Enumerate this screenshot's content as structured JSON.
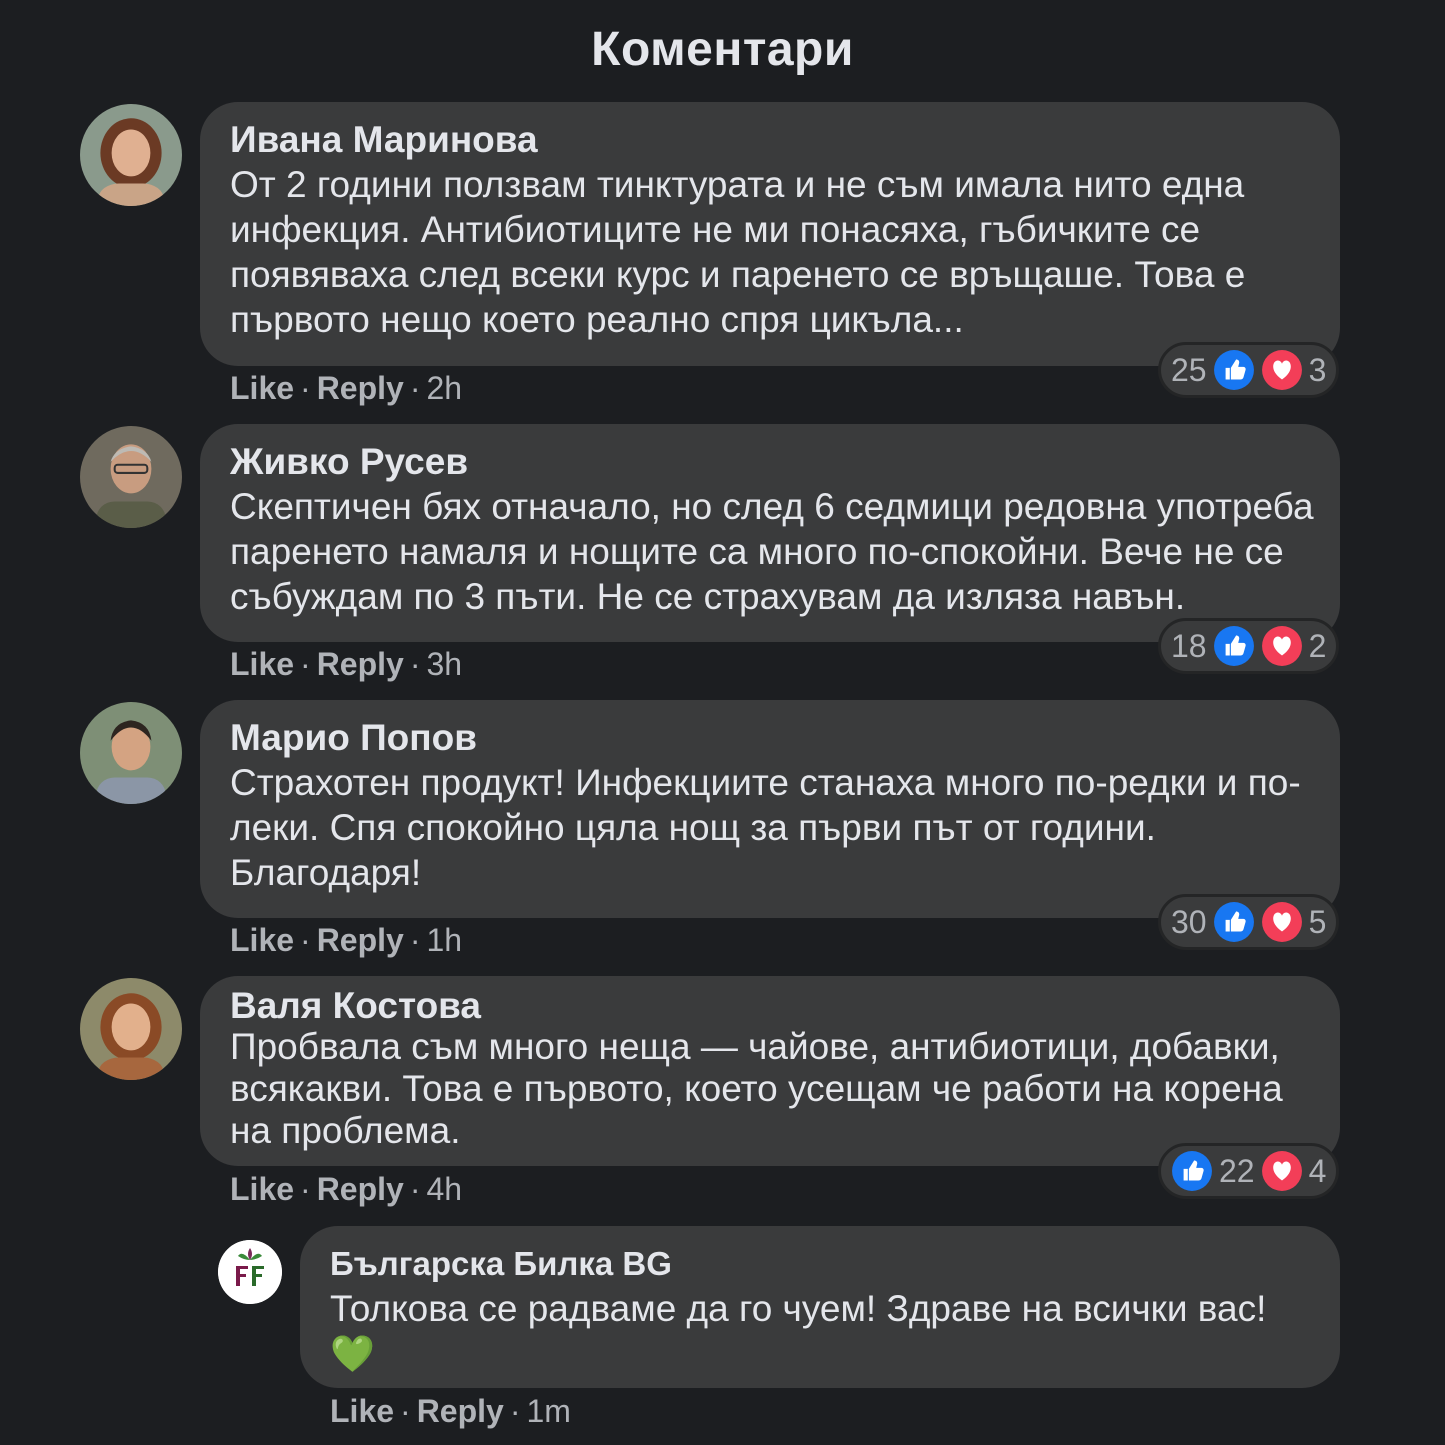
{
  "header": {
    "title": "Коментари"
  },
  "actions": {
    "like": "Like",
    "reply": "Reply",
    "sep": "·"
  },
  "comments": [
    {
      "author": "Ивана Маринова",
      "text": "От 2 години ползвам тинктурата и не съм имала нито една инфекция. Антибиотиците не ми понасяха, гъбичките се появяваха след всеки курс и паренето се връщаше. Това е първото нещо което реално спря цикъла...",
      "time": "2h",
      "likes": "25",
      "hearts": "3"
    },
    {
      "author": "Живко Русев",
      "text": "Скептичен бях отначало, но след 6 седмици редовна употреба паренето намаля и нощите са много по-спокойни. Вече не се събуждам по 3 пъти. Не се страхувам да изляза навън.",
      "time": "3h",
      "likes": "18",
      "hearts": "2"
    },
    {
      "author": "Марио Попов",
      "text": "Страхотен продукт! Инфекциите станаха много по-редки и по-леки. Спя спокойно цяла нощ за първи път от години. Благодаря!",
      "time": "1h",
      "likes": "30",
      "hearts": "5"
    },
    {
      "author": "Валя Костова",
      "text": "Пробвала съм много неща — чайове, антибиотици, добавки, всякакви. Това е първото, което усещам че работи на корена на проблема.",
      "time": "4h",
      "likes": "22",
      "hearts": "4"
    }
  ],
  "reply": {
    "author": "Българска Билка BG",
    "text": "Толкова се радваме да го чуем! Здраве на всички вас!",
    "emoji": "💚",
    "time": "1m"
  },
  "colors": {
    "like_blue": "#1877f2",
    "heart_red": "#f33e58",
    "bubble": "#3a3b3c",
    "background": "#1c1e21"
  }
}
